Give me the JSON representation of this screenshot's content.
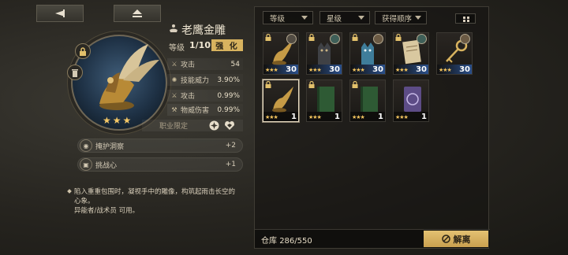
{
  "item": {
    "name": "老鹰金雕",
    "level_label": "等级",
    "level_value": "1/10",
    "enhance_label": "强 化",
    "class_restriction_label": "职业限定"
  },
  "stats": [
    {
      "icon": "attack-icon",
      "label": "攻击",
      "value": "54"
    },
    {
      "icon": "skill-power-icon",
      "label": "技能威力",
      "value": "3.90%"
    },
    {
      "icon": "attack-icon",
      "label": "攻击",
      "value": "0.99%"
    },
    {
      "icon": "physical-damage-icon",
      "label": "物威伤害",
      "value": "0.99%"
    }
  ],
  "skills": [
    {
      "label": "掩护洞察",
      "value": "+2"
    },
    {
      "label": "挑战心",
      "value": "+1"
    }
  ],
  "description": {
    "line1": "陷入重重包围时，凝视手中的雕像，构筑起雨击长空的",
    "line2": "心象。",
    "line3": "异能者/战术员 可用。"
  },
  "filters": [
    {
      "label": "等级"
    },
    {
      "label": "星级"
    },
    {
      "label": "获得顺序"
    }
  ],
  "inventory": [
    {
      "name": "eagle-statue",
      "count": "30",
      "stars": "★★★",
      "locked": true,
      "blue": true
    },
    {
      "name": "dark-cat-figure",
      "count": "30",
      "stars": "★★★",
      "locked": true,
      "blue": true
    },
    {
      "name": "blue-cat-figure",
      "count": "30",
      "stars": "★★★",
      "locked": true,
      "blue": true
    },
    {
      "name": "paper-scroll",
      "count": "30",
      "stars": "★★★",
      "locked": true,
      "blue": true
    },
    {
      "name": "golden-key",
      "count": "30",
      "stars": "★★★",
      "locked": false,
      "blue": true
    },
    {
      "name": "eagle-statue-selected",
      "count": "1",
      "stars": "★★★",
      "locked": true,
      "blue": false
    },
    {
      "name": "green-book",
      "count": "1",
      "stars": "★★★",
      "locked": true,
      "blue": false
    },
    {
      "name": "green-book-2",
      "count": "1",
      "stars": "★★★",
      "locked": true,
      "blue": false
    },
    {
      "name": "purple-card",
      "count": "1",
      "stars": "★★★",
      "locked": false,
      "blue": false
    }
  ],
  "storage": {
    "label": "仓库",
    "value": "286/550"
  },
  "dismantle_label": "解离",
  "colors": {
    "accent_gold": "#d8b35f",
    "star_gold": "#f2c35e",
    "count_blue": "#2a4f8a"
  }
}
